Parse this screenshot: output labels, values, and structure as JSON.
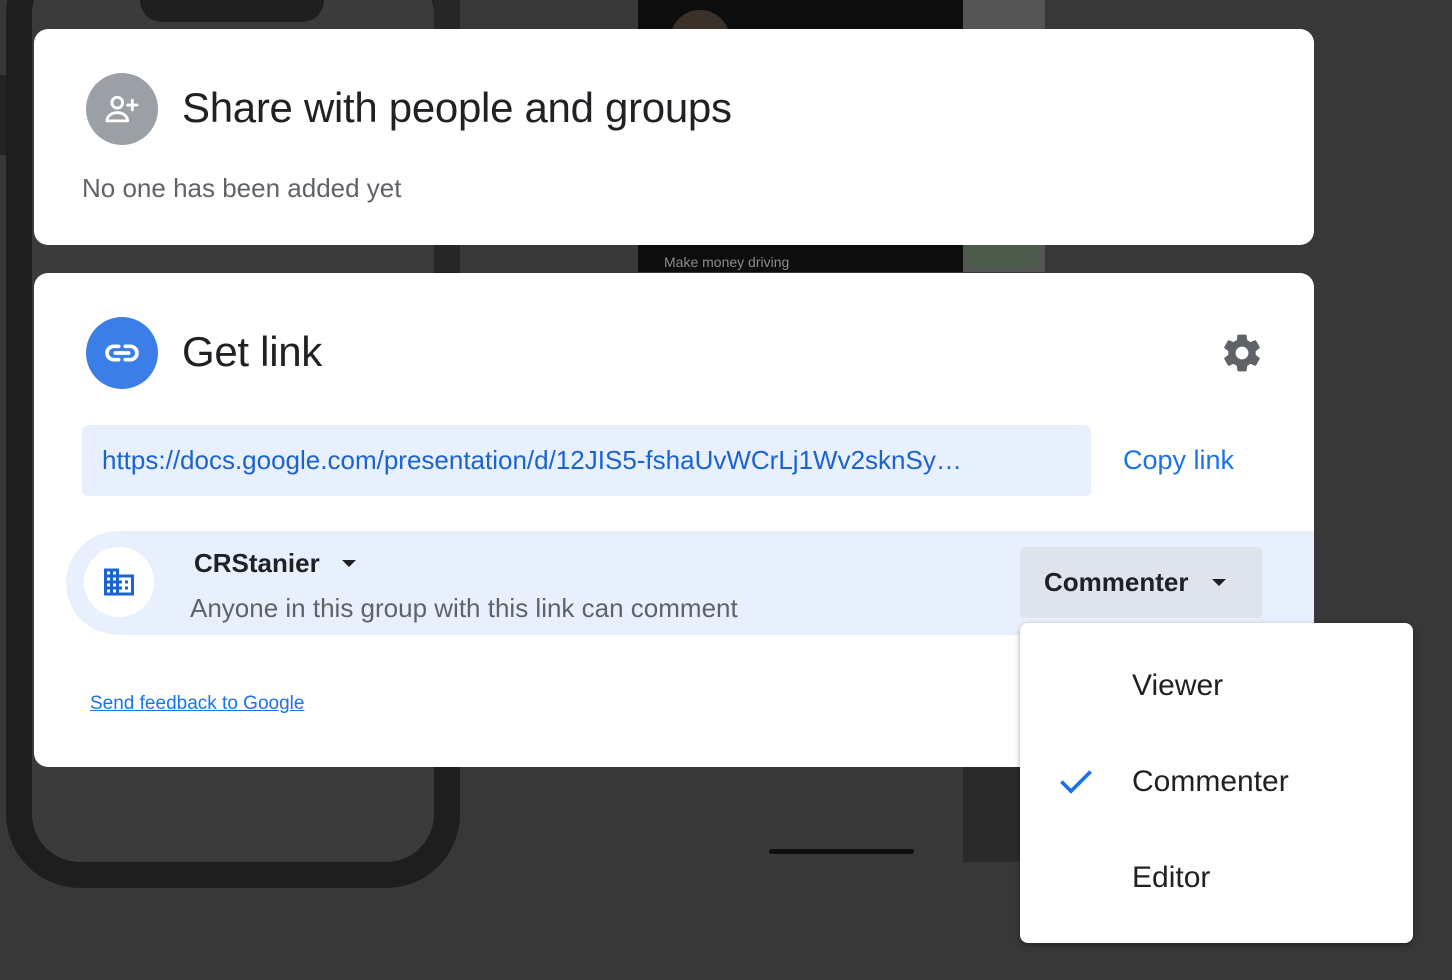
{
  "share_card": {
    "icon": "person-add-icon",
    "title": "Share with people and groups",
    "subtitle": "No one has been added yet"
  },
  "link_card": {
    "icon": "link-icon",
    "title": "Get link",
    "settings_icon": "gear-icon",
    "url": "https://docs.google.com/presentation/d/12JIS5-fshaUvWCrLj1Wv2sknSy…",
    "copy_link_label": "Copy link",
    "access": {
      "icon": "building-icon",
      "group_name": "CRStanier",
      "description": "Anyone in this group with this link can comment",
      "role": "Commenter"
    },
    "feedback_link": "Send feedback to Google"
  },
  "role_menu": {
    "items": [
      {
        "label": "Viewer",
        "selected": false
      },
      {
        "label": "Commenter",
        "selected": true
      },
      {
        "label": "Editor",
        "selected": false
      }
    ]
  },
  "background": {
    "video_caption": "Make money driving"
  },
  "colors": {
    "accent": "#1a73e8",
    "link_avatar": "#3b7ee8",
    "share_avatar": "#9aa0a6",
    "highlight": "#e8f0fe"
  }
}
